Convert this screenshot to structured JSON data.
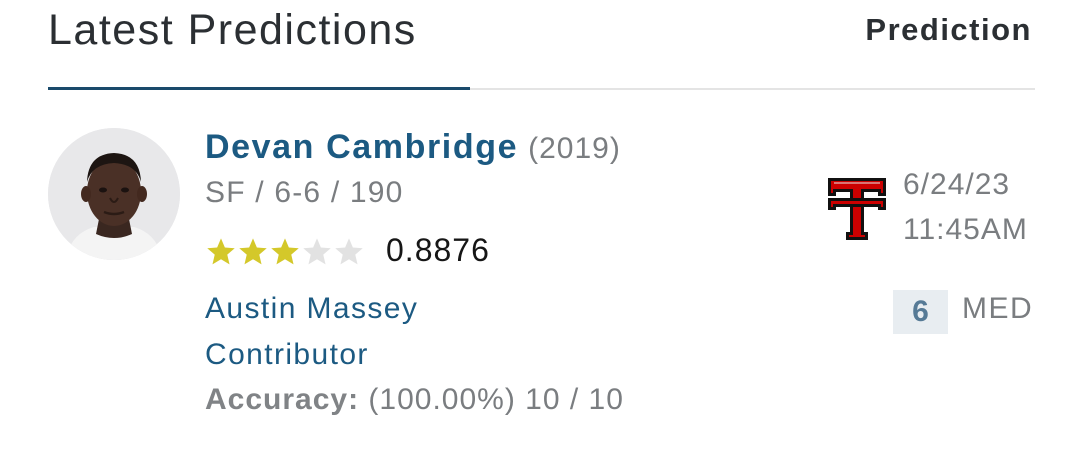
{
  "header": {
    "title": "Latest Predictions",
    "column_label": "Prediction"
  },
  "prediction": {
    "player": {
      "name": "Devan Cambridge",
      "year": "(2019)",
      "info": "SF / 6-6 / 190",
      "stars": 3,
      "max_stars": 5,
      "rating": "0.8876",
      "photo_icon": "player-photo"
    },
    "predictor": {
      "name": "Austin Massey",
      "role": "Contributor",
      "accuracy_label": "Accuracy:",
      "accuracy_value": "(100.00%) 10 / 10"
    },
    "team_logo_icon": "texas-tech-logo",
    "date": "6/24/23",
    "time": "11:45AM",
    "confidence": "6",
    "confidence_label": "MED"
  },
  "colors": {
    "accent": "#1c5a82",
    "star_filled": "#d4c82a",
    "star_empty": "#e2e2e2",
    "team_red": "#cc0000"
  }
}
